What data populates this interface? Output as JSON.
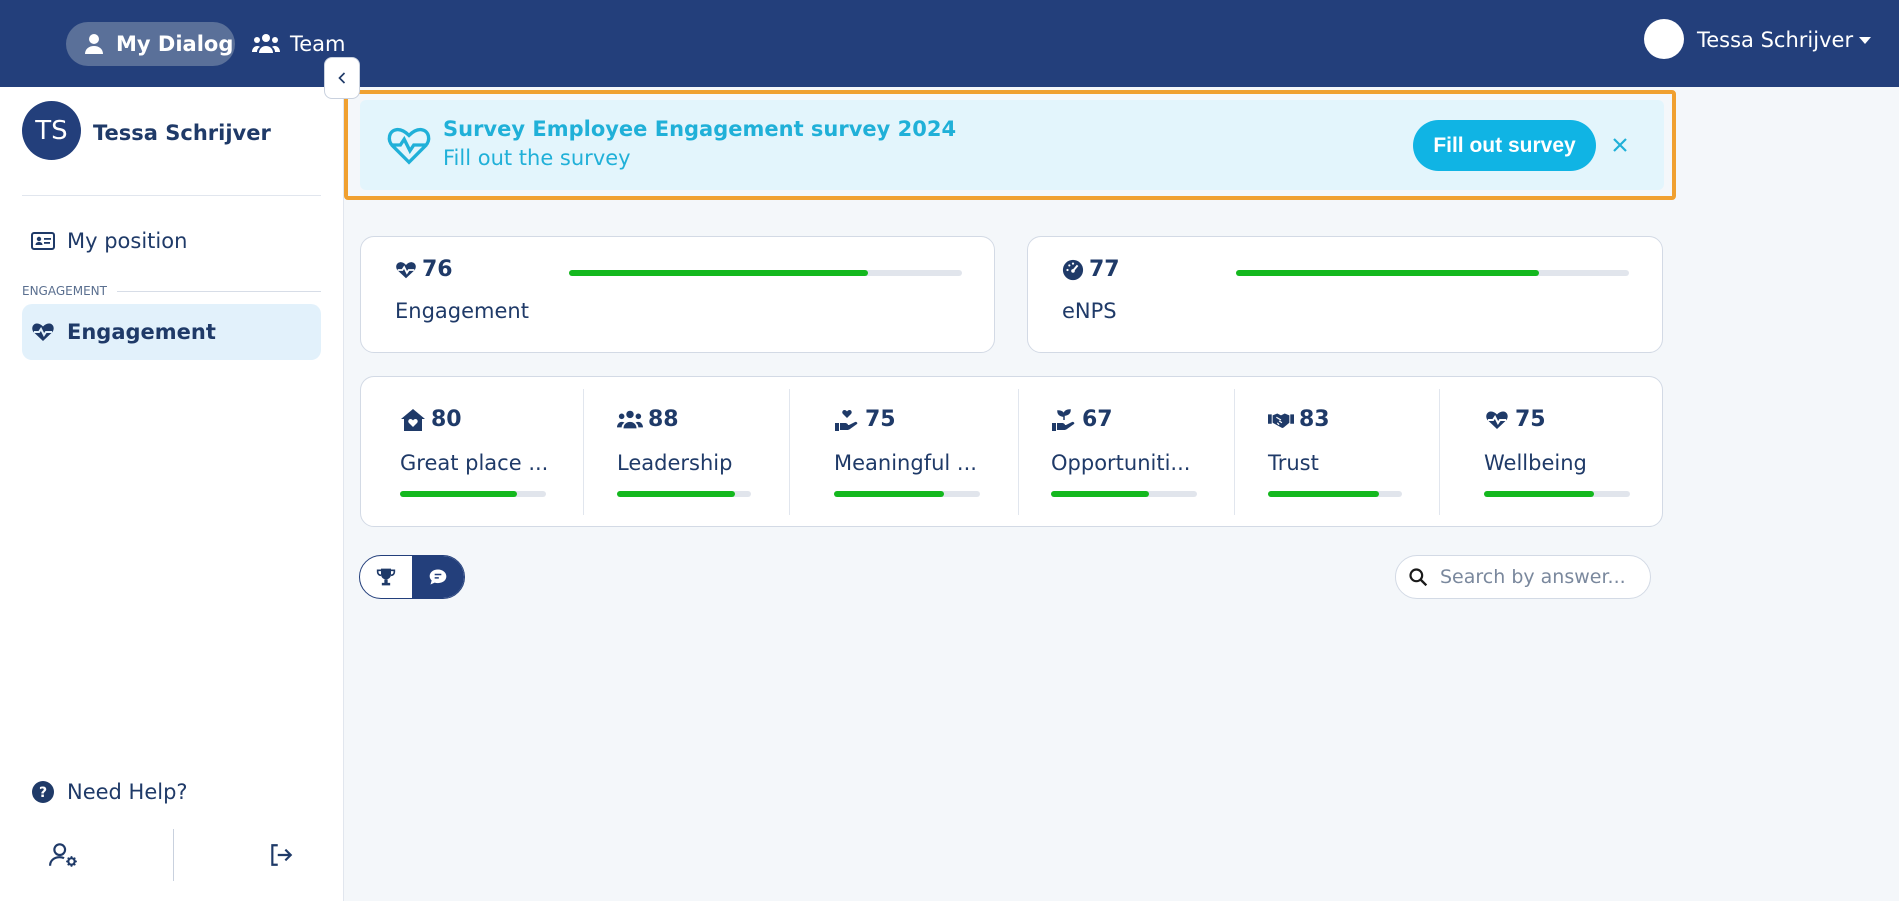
{
  "nav": {
    "items": [
      {
        "label": "My Dialog",
        "icon": "user-icon",
        "active": true
      },
      {
        "label": "Team",
        "icon": "users-icon",
        "active": false
      }
    ],
    "user_name": "Tessa Schrijver"
  },
  "sidebar": {
    "avatar_initials": "TS",
    "user_name": "Tessa Schrijver",
    "my_position_label": "My position",
    "section_label": "ENGAGEMENT",
    "engagement_label": "Engagement",
    "help_label": "Need Help?"
  },
  "banner": {
    "title": "Survey Employee Engagement survey 2024",
    "subtitle": "Fill out the survey",
    "button_label": "Fill out survey"
  },
  "kpis": [
    {
      "value": "76",
      "label": "Engagement",
      "progress": 0.76,
      "icon": "heart-pulse-icon"
    },
    {
      "value": "77",
      "label": "eNPS",
      "progress": 0.77,
      "icon": "gauge-icon"
    }
  ],
  "subscores": [
    {
      "value": "80",
      "label": "Great place ...",
      "progress": 0.8,
      "icon": "house-heart-icon"
    },
    {
      "value": "88",
      "label": "Leadership",
      "progress": 0.88,
      "icon": "users-icon"
    },
    {
      "value": "75",
      "label": "Meaningful ...",
      "progress": 0.75,
      "icon": "hand-heart-icon"
    },
    {
      "value": "67",
      "label": "Opportuniti...",
      "progress": 0.67,
      "icon": "hand-seedling-icon"
    },
    {
      "value": "83",
      "label": "Trust",
      "progress": 0.83,
      "icon": "handshake-icon"
    },
    {
      "value": "75",
      "label": "Wellbeing",
      "progress": 0.75,
      "icon": "heart-pulse-icon"
    }
  ],
  "search": {
    "placeholder": "Search by answer..."
  },
  "colors": {
    "nav_bg": "#233f7b",
    "accent": "#10b4e4",
    "progress": "#14b81e",
    "banner_outline": "#f0a030"
  }
}
